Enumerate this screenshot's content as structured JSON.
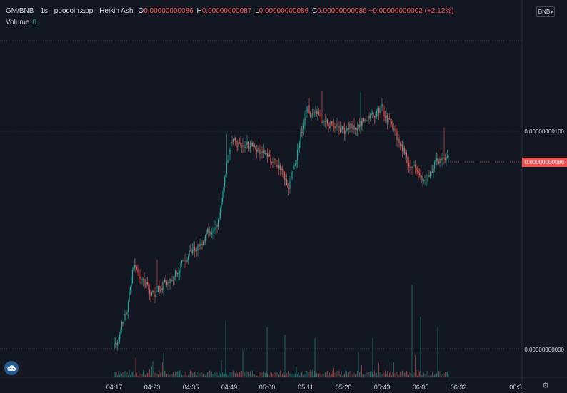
{
  "legend": {
    "symbol": "GM/BNB · 1s · poocoin.app · Heikin Ashi",
    "open_key": "O",
    "open": "0.00000000086",
    "high_key": "H",
    "high": "0.00000000087",
    "low_key": "L",
    "low": "0.00000000086",
    "close_key": "C",
    "close": "0.00000000086",
    "change": "+0.00000000002 (+2.12%)"
  },
  "volume": {
    "label": "Volume",
    "value": "0"
  },
  "currency_button": {
    "label": "BNB",
    "icon": "chevron-down-icon"
  },
  "price_axis": {
    "labels": [
      "0.00000000100",
      "0.00000000000"
    ],
    "last_price": "0.00000000086"
  },
  "time_axis": {
    "labels": [
      "04:17",
      "04:23",
      "04:35",
      "04:49",
      "05:00",
      "05:11",
      "05:26",
      "05:43",
      "06:05",
      "06:32",
      "06:3"
    ]
  },
  "icons": {
    "logo": "cloud-logo-icon",
    "settings": "gear-icon"
  },
  "colors": {
    "background": "#131722",
    "up": "#26a69a",
    "down": "#ef5350",
    "text": "#d1d4dc",
    "grid": "#2a2e39"
  },
  "chart_data": {
    "type": "candlestick",
    "style": "Heikin Ashi",
    "symbol": "GM/BNB",
    "interval": "1s",
    "y_axis_unit": "BNB",
    "price_path_keypoints": [
      [
        "04:17",
        0.0
      ],
      [
        "04:19",
        2e-10
      ],
      [
        "04:20",
        4e-10
      ],
      [
        "04:23",
        2.4e-10
      ],
      [
        "04:35",
        4.4e-10
      ],
      [
        "04:45",
        6e-10
      ],
      [
        "04:49",
        9.5e-10
      ],
      [
        "05:00",
        9e-10
      ],
      [
        "05:06",
        7.5e-10
      ],
      [
        "05:11",
        1.1e-09
      ],
      [
        "05:26",
        1e-09
      ],
      [
        "05:43",
        1.1e-09
      ],
      [
        "06:05",
        7.5e-10
      ],
      [
        "06:20",
        9e-10
      ],
      [
        "06:25",
        8.6e-10
      ]
    ],
    "last_price": 8.6e-10,
    "volume_spikes_at": [
      "05:00",
      "05:43",
      "06:05"
    ]
  }
}
